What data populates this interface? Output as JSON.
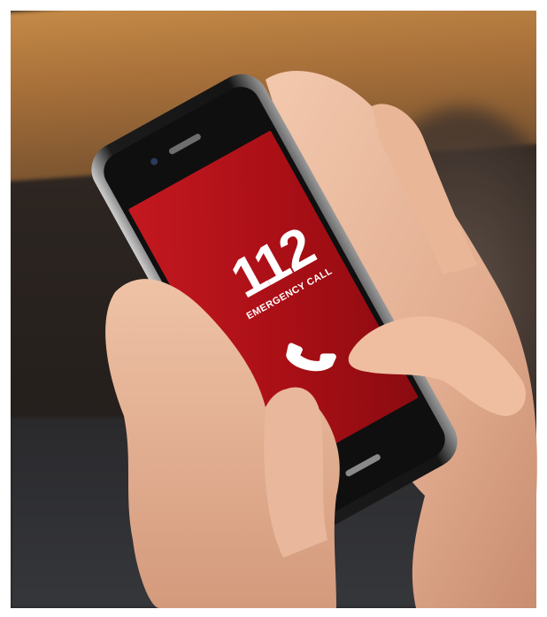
{
  "phone_screen": {
    "number": "112",
    "label": "EMERGENCY CALL",
    "icon": "phone-handset-icon"
  },
  "colors": {
    "screen_red": "#b3121a",
    "phone_body": "#1a1a1a",
    "skin": "#e8b79c"
  }
}
